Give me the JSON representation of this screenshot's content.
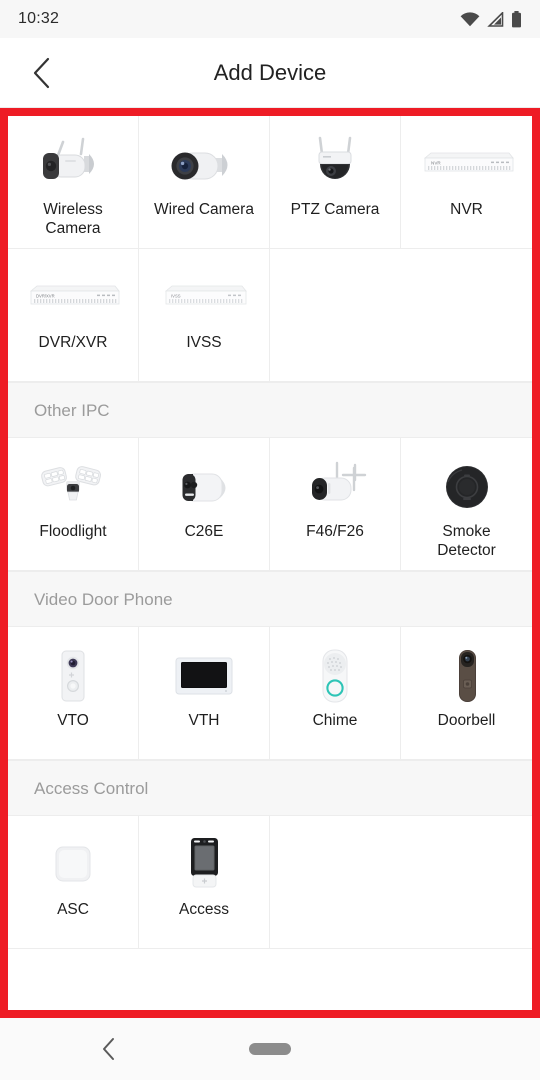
{
  "status_bar": {
    "time": "10:32",
    "icons": [
      "wifi-icon",
      "cellular-signal-icon",
      "battery-icon"
    ]
  },
  "header": {
    "title": "Add Device",
    "back_icon": "chevron-left-icon"
  },
  "annotation": {
    "border_color": "#ee1c25"
  },
  "sections": [
    {
      "title": "",
      "items": [
        {
          "label": "Wireless Camera",
          "icon": "wireless-bullet-camera-icon"
        },
        {
          "label": "Wired Camera",
          "icon": "wired-bullet-camera-icon"
        },
        {
          "label": "PTZ Camera",
          "icon": "ptz-dome-camera-icon"
        },
        {
          "label": "NVR",
          "icon": "nvr-recorder-icon",
          "device_text": "NVR"
        },
        {
          "label": "DVR/XVR",
          "icon": "dvr-recorder-icon",
          "device_text": "DVR/XVR"
        },
        {
          "label": "IVSS",
          "icon": "ivss-recorder-icon",
          "device_text": "IVSS"
        }
      ]
    },
    {
      "title": "Other IPC",
      "items": [
        {
          "label": "Floodlight",
          "icon": "floodlight-camera-icon"
        },
        {
          "label": "C26E",
          "icon": "c26e-camera-icon"
        },
        {
          "label": "F46/F26",
          "icon": "f46-f26-camera-icon"
        },
        {
          "label": "Smoke Detector",
          "icon": "smoke-detector-icon"
        }
      ]
    },
    {
      "title": "Video Door Phone",
      "items": [
        {
          "label": "VTO",
          "icon": "vto-door-station-icon"
        },
        {
          "label": "VTH",
          "icon": "vth-indoor-monitor-icon"
        },
        {
          "label": "Chime",
          "icon": "chime-icon"
        },
        {
          "label": "Doorbell",
          "icon": "doorbell-icon"
        }
      ]
    },
    {
      "title": "Access Control",
      "items": [
        {
          "label": "ASC",
          "icon": "asc-controller-icon"
        },
        {
          "label": "Access",
          "icon": "access-terminal-icon"
        }
      ]
    }
  ],
  "nav_bar": {
    "back_icon": "nav-back-icon",
    "home_indicator": "home-pill-indicator"
  },
  "colors": {
    "accent_red": "#ee1c25",
    "section_header_bg": "#f7f7f7",
    "section_header_text": "#9b9b9b",
    "divider": "#ededed",
    "label_text": "#1f1f1f"
  }
}
